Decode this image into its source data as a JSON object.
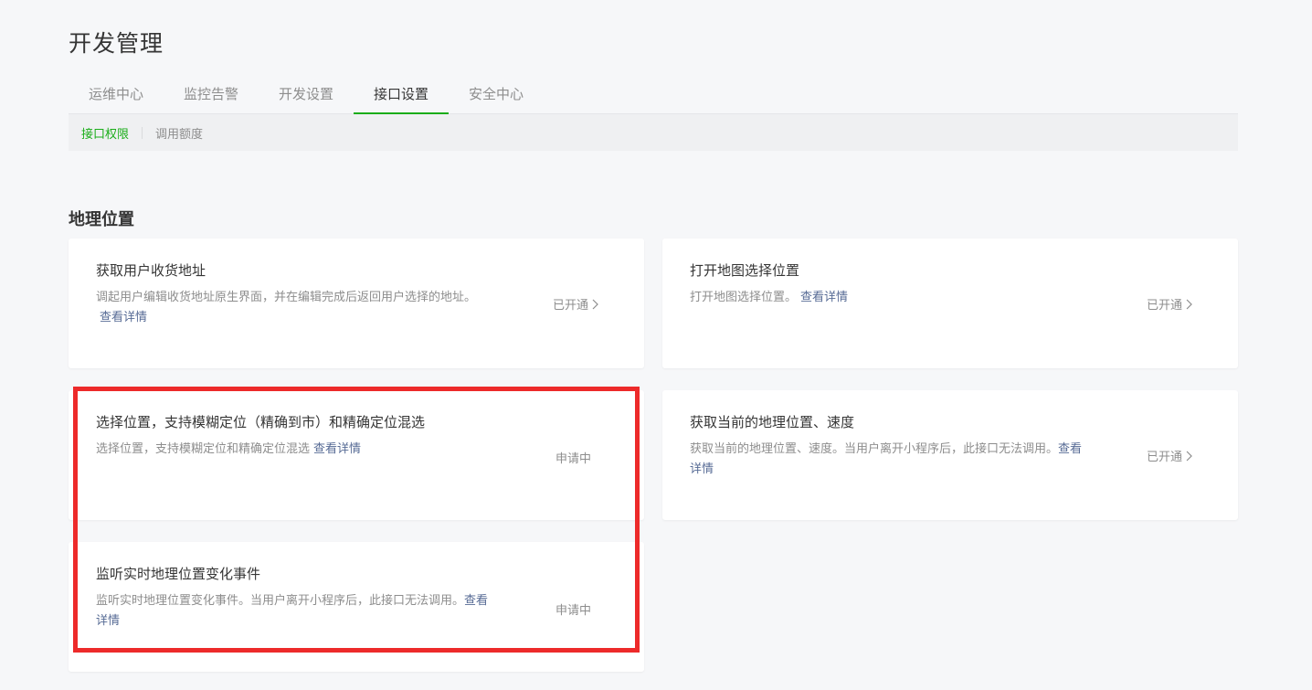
{
  "page_title": "开发管理",
  "tabs": [
    {
      "label": "运维中心"
    },
    {
      "label": "监控告警"
    },
    {
      "label": "开发设置"
    },
    {
      "label": "接口设置"
    },
    {
      "label": "安全中心"
    }
  ],
  "subnav": [
    {
      "label": "接口权限"
    },
    {
      "label": "调用额度"
    }
  ],
  "section_title": "地理位置",
  "link_text": "查看详情",
  "cards": [
    {
      "title": "获取用户收货地址",
      "desc": "调起用户编辑收货地址原生界面，并在编辑完成后返回用户选择的地址。",
      "status": "已开通"
    },
    {
      "title": "打开地图选择位置",
      "desc": "打开地图选择位置。",
      "status": "已开通"
    },
    {
      "title": "选择位置，支持模糊定位（精确到市）和精确定位混选",
      "desc": "选择位置，支持模糊定位和精确定位混选",
      "status": "申请中"
    },
    {
      "title": "获取当前的地理位置、速度",
      "desc": "获取当前的地理位置、速度。当用户离开小程序后，此接口无法调用。",
      "status": "已开通"
    },
    {
      "title": "监听实时地理位置变化事件",
      "desc": "监听实时地理位置变化事件。当用户离开小程序后，此接口无法调用。",
      "status": "申请中"
    }
  ],
  "colors": {
    "accent": "#1aad19",
    "link": "#576b95",
    "highlight": "#ed2a2a"
  }
}
